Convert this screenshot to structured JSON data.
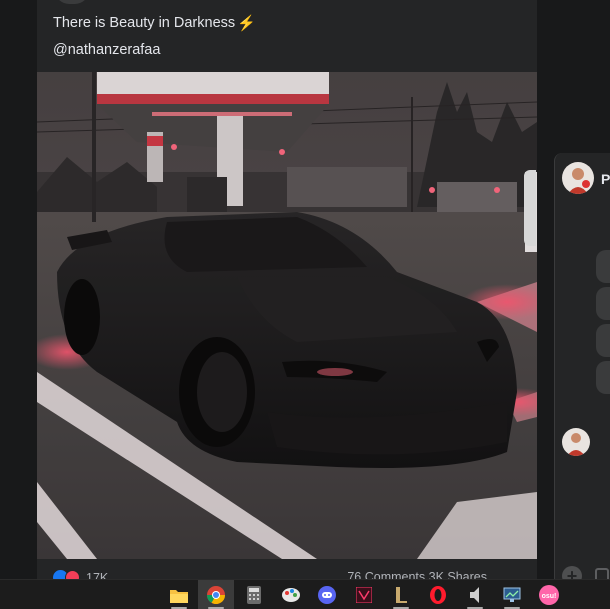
{
  "post": {
    "caption": "There is Beauty in Darkness",
    "caption_emoji": "⚡",
    "handle": "@nathanzerafaa",
    "reaction_count": "17K",
    "comments_shares": "76 Comments  3K Shares"
  },
  "chat": {
    "contact_initial": "P",
    "add_label": "+"
  },
  "taskbar": {
    "apps": [
      "file-explorer-icon",
      "chrome-icon",
      "calculator-icon",
      "paint-icon",
      "discord-icon",
      "affinity-icon",
      "league-of-legends-icon",
      "opera-icon",
      "volume-icon",
      "monitor-icon",
      "osu-icon"
    ],
    "osu_label": "osu!"
  },
  "colors": {
    "background": "#18191a",
    "card": "#242526",
    "accent_blue": "#1877f2",
    "accent_red": "#f33e58",
    "neon_red": "#ff4d6a"
  }
}
